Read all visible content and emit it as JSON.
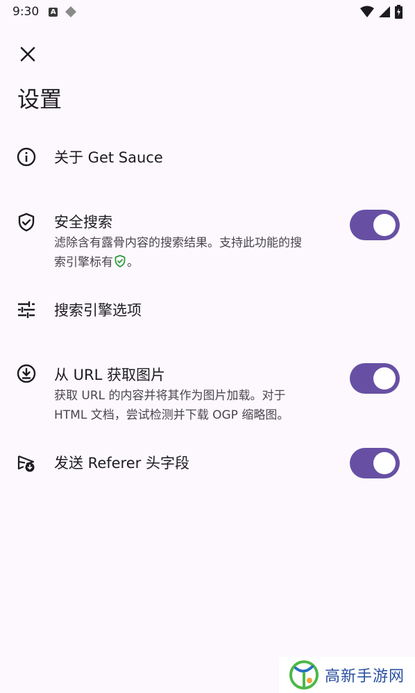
{
  "status_bar": {
    "time": "9:30",
    "icons": [
      "a-notification-icon",
      "tag-icon",
      "wifi-icon",
      "signal-icon",
      "battery-icon"
    ]
  },
  "toolbar": {
    "close_icon": "close-icon"
  },
  "page": {
    "title": "设置"
  },
  "settings": {
    "about": {
      "title": "关于 Get Sauce",
      "icon": "info-icon"
    },
    "safe_search": {
      "title": "安全搜索",
      "desc_line1": "滤除含有露骨内容的搜索结果。支持此功能的搜",
      "desc_line2_before": "索引擎标有",
      "desc_line2_after": "。",
      "icon": "shield-check-icon",
      "enabled": true
    },
    "engine_options": {
      "title": "搜索引擎选项",
      "icon": "tune-icon"
    },
    "fetch_from_url": {
      "title": "从 URL 获取图片",
      "desc_line1": "获取 URL 的内容并将其作为图片加载。对于",
      "desc_line2": "HTML 文档，尝试检测并下载 OGP 缩略图。",
      "icon": "download-circle-icon",
      "enabled": true
    },
    "send_referer": {
      "title": "发送 Referer 头字段",
      "icon": "send-download-icon",
      "enabled": true
    }
  },
  "colors": {
    "accent": "#6750a4",
    "background": "#fdf8fd",
    "shield_green": "#2e9a3e"
  },
  "watermark": {
    "text": "高新手游网"
  }
}
